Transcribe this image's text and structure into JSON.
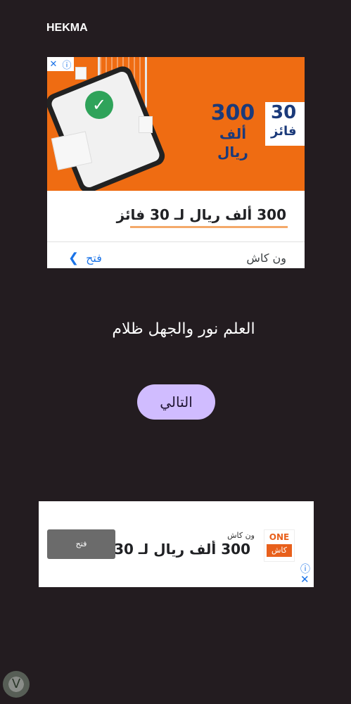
{
  "app": {
    "title": "HEKMA"
  },
  "ad_top": {
    "banner_amount": "300",
    "banner_unit": "ألف ريال",
    "banner_tag_amount": "30",
    "banner_tag_unit": "فائز",
    "headline": "300 ألف ريال لـ 30 فائز",
    "advertiser": "ون كاش",
    "open_label": "فتح"
  },
  "proverb": "العلم نور والجهل ظلام",
  "next_button": "التالي",
  "ad_bottom": {
    "advertiser": "ون كاش",
    "headline": "300 ألف ريال لـ 30 فائز",
    "open_label": "فتح",
    "logo_top": "ONE",
    "logo_bottom": "كاش"
  },
  "colors": {
    "background": "#231c20",
    "button": "#d0bcff",
    "ad_orange": "#ef6c12",
    "link_blue": "#1a73e8"
  },
  "icons": [
    "ad-info-icon",
    "ad-close-icon",
    "chevron-icon",
    "check-icon",
    "shopping-cart-icon",
    "logo-watermark-icon"
  ]
}
